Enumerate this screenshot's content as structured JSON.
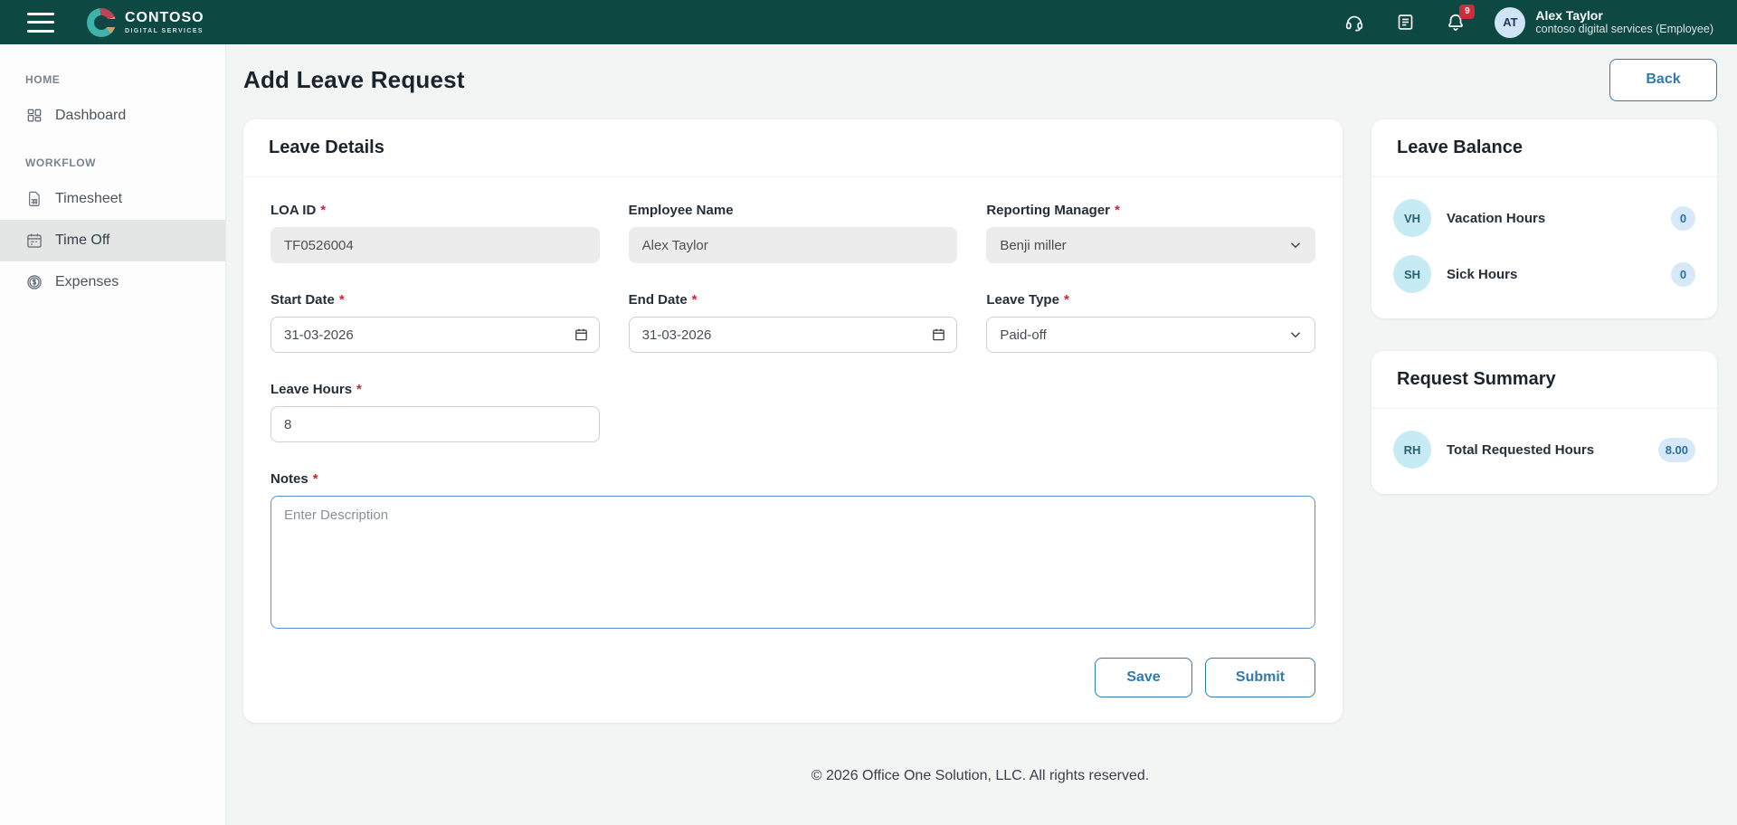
{
  "header": {
    "brand": {
      "name": "CONTOSO",
      "tagline": "DIGITAL SERVICES"
    },
    "notification_count": "9",
    "user": {
      "initials": "AT",
      "name": "Alex Taylor",
      "org": "contoso digital services (Employee)"
    }
  },
  "sidebar": {
    "sections": [
      {
        "label": "HOME",
        "items": [
          {
            "label": "Dashboard",
            "icon": "dashboard-grid-icon"
          }
        ]
      },
      {
        "label": "WORKFLOW",
        "items": [
          {
            "label": "Timesheet",
            "icon": "timesheet-document-icon"
          },
          {
            "label": "Time Off",
            "icon": "calendar-icon",
            "active": true
          },
          {
            "label": "Expenses",
            "icon": "dollar-coin-icon"
          }
        ]
      }
    ]
  },
  "page": {
    "title": "Add Leave Request",
    "back_label": "Back"
  },
  "form": {
    "card_title": "Leave Details",
    "required_marker": "*",
    "fields": {
      "loa_id": {
        "label": "LOA ID",
        "value": "TF0526004"
      },
      "employee_name": {
        "label": "Employee Name",
        "value": "Alex Taylor"
      },
      "reporting_manager": {
        "label": "Reporting Manager",
        "value": "Benji miller"
      },
      "start_date": {
        "label": "Start Date",
        "value": "31-03-2026"
      },
      "end_date": {
        "label": "End Date",
        "value": "31-03-2026"
      },
      "leave_type": {
        "label": "Leave Type",
        "value": "Paid-off"
      },
      "leave_hours": {
        "label": "Leave Hours",
        "value": "8"
      },
      "notes": {
        "label": "Notes",
        "placeholder": "Enter Description"
      }
    },
    "buttons": {
      "save": "Save",
      "submit": "Submit"
    }
  },
  "leave_balance": {
    "title": "Leave Balance",
    "rows": [
      {
        "initials": "VH",
        "label": "Vacation Hours",
        "value": "0"
      },
      {
        "initials": "SH",
        "label": "Sick Hours",
        "value": "0"
      }
    ]
  },
  "request_summary": {
    "title": "Request Summary",
    "rows": [
      {
        "initials": "RH",
        "label": "Total Requested Hours",
        "value": "8.00"
      }
    ]
  },
  "footer": {
    "copyright": "© 2026 Office One Solution, LLC. All rights reserved."
  },
  "colors": {
    "header_teal": "#0d4842",
    "accent_blue": "#2e7bac",
    "badge_red": "#ce2b3c",
    "avatar_cyan": "#c7ebf4",
    "badge_blue_bg": "#d7e8f8",
    "active_item_bg": "#e4e5e5"
  }
}
